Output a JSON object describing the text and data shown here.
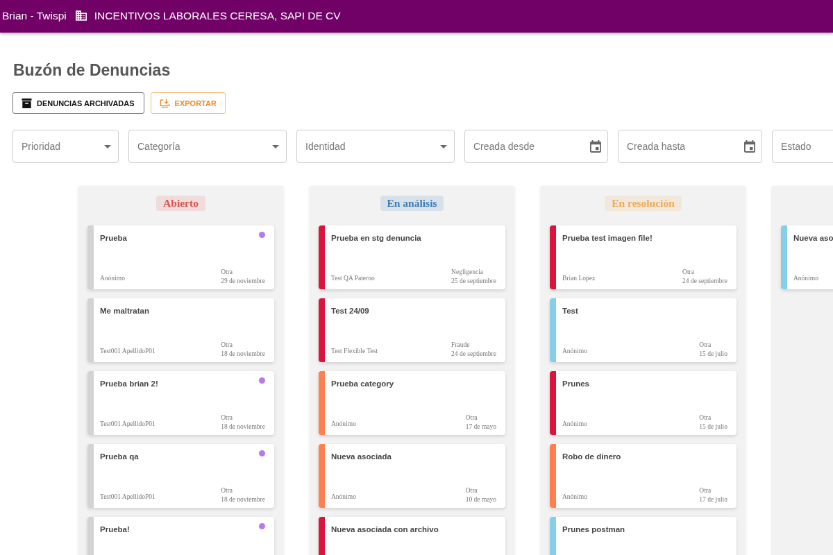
{
  "top_bar": {
    "user": "Brian - Twispi",
    "company": "INCENTIVOS LABORALES CERESA, SAPI DE CV"
  },
  "page_title": "Buzón de Denuncias",
  "actions": [
    {
      "label": "DENUNCIAS ARCHIVADAS",
      "kind": "archive"
    },
    {
      "label": "EXPORTAR",
      "kind": "export"
    }
  ],
  "filters": [
    {
      "placeholder": "Prioridad",
      "kind": "select"
    },
    {
      "placeholder": "Categoría",
      "kind": "select"
    },
    {
      "placeholder": "Identidad",
      "kind": "select"
    },
    {
      "placeholder": "Creada desde",
      "kind": "date"
    },
    {
      "placeholder": "Creada hasta",
      "kind": "date"
    },
    {
      "placeholder": "Estado",
      "kind": "text"
    }
  ],
  "columns": [
    {
      "title": "Abierto",
      "color": "#d9534f",
      "cards": [
        {
          "title": "Prueba",
          "author": "Anónimo",
          "category": "Otra",
          "date": "29 de noviembre",
          "color": "#d3d3d3",
          "unread": true
        },
        {
          "title": "Me maltratan",
          "author": "Test001 ApellidoP01",
          "category": "Otra",
          "date": "18 de noviembre",
          "color": "#d3d3d3",
          "unread": false
        },
        {
          "title": "Prueba brian 2!",
          "author": "Test001 ApellidoP01",
          "category": "Otra",
          "date": "18 de noviembre",
          "color": "#d3d3d3",
          "unread": true
        },
        {
          "title": "Prueba qa",
          "author": "Test001 ApellidoP01",
          "category": "Otra",
          "date": "18 de noviembre",
          "color": "#d3d3d3",
          "unread": true
        },
        {
          "title": "Prueba!",
          "color": "#d3d3d3",
          "unread": true
        }
      ]
    },
    {
      "title": "En análisis",
      "color": "#3a7bb8",
      "cards": [
        {
          "title": "Prueba en stg denuncia",
          "author": "Test QA Paterno",
          "category": "Negligencia",
          "date": "25 de septiembre",
          "color": "#dc143c",
          "unread": false
        },
        {
          "title": "Test 24/09",
          "author": "Test Flexible Test",
          "category": "Fraude",
          "date": "24 de septiembre",
          "color": "#dc143c",
          "unread": false
        },
        {
          "title": "Prueba category",
          "author": "Anónimo",
          "category": "Otra",
          "date": "17 de mayo",
          "color": "#ff7f50",
          "unread": false
        },
        {
          "title": "Nueva asociada",
          "author": "Anónimo",
          "category": "Otra",
          "date": "10 de mayo",
          "color": "#ff7f50",
          "unread": false
        },
        {
          "title": "Nueva asociada con archivo",
          "color": "#dc143c",
          "unread": false
        }
      ]
    },
    {
      "title": "En resolución",
      "color": "#eeaa55",
      "cards": [
        {
          "title": "Prueba test imagen file!",
          "author": "Brian Lopez",
          "category": "Otra",
          "date": "24 de septiembre",
          "color": "#dc143c",
          "unread": false
        },
        {
          "title": "Test",
          "author": "Anónimo",
          "category": "Otra",
          "date": "15 de julio",
          "color": "#87ceeb",
          "unread": false
        },
        {
          "title": "Prunes",
          "author": "Anónimo",
          "category": "Otra",
          "date": "15 de julio",
          "color": "#dc143c",
          "unread": false
        },
        {
          "title": "Robo de dinero",
          "author": "Anónimo",
          "category": "Otra",
          "date": "17 de julio",
          "color": "#ff7f50",
          "unread": false
        },
        {
          "title": "Prunes postman",
          "color": "#87ceeb",
          "unread": false
        }
      ]
    },
    {
      "cards": [
        {
          "title": "Nueva aso",
          "author": "Anónimo",
          "color": "#87ceeb"
        }
      ]
    }
  ]
}
